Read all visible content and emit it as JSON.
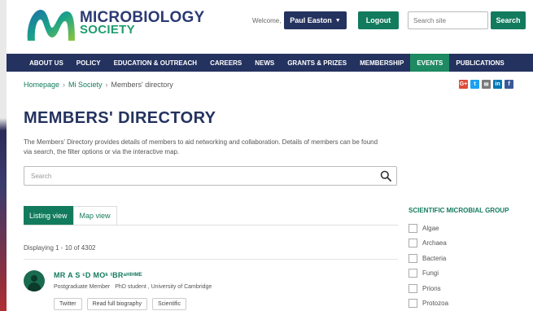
{
  "header": {
    "logo_line1": "MICROBIOLOGY",
    "logo_line2": "SOCIETY",
    "welcome": "Welcome,",
    "user_name": "Paul Easton",
    "logout": "Logout",
    "search_placeholder": "Search site",
    "search_button": "Search"
  },
  "nav": {
    "items": [
      "ABOUT US",
      "POLICY",
      "EDUCATION & OUTREACH",
      "CAREERS",
      "NEWS",
      "GRANTS & PRIZES",
      "MEMBERSHIP",
      "EVENTS",
      "PUBLICATIONS"
    ],
    "active": "EVENTS"
  },
  "breadcrumb": {
    "items": [
      "Homepage",
      "Mi Society",
      "Members' directory"
    ]
  },
  "share": {
    "icons": [
      "google-plus-icon",
      "twitter-icon",
      "email-icon",
      "linkedin-icon",
      "facebook-icon"
    ],
    "glyphs": [
      "G+",
      "t",
      "✉",
      "in",
      "f"
    ],
    "colors": [
      "#dd4b39",
      "#1da1f2",
      "#7a7a7a",
      "#0077b5",
      "#3b5998"
    ]
  },
  "page": {
    "title": "MEMBERS' DIRECTORY",
    "intro": "The Members' Directory provides details of members to aid networking and collaboration. Details of members can be found via search, the filter options or via the interactive map.",
    "search_placeholder": "Search"
  },
  "tabs": {
    "listing": "Listing view",
    "map": "Map view"
  },
  "results": {
    "count_text": "Displaying 1 - 10 of 4302"
  },
  "member": {
    "name": "MR A S ᵋD MOᵏ ᵗBRᵃᴴᴵᴴᴹᴱ",
    "membership": "Postgraduate Member",
    "position": "PhD student , University of Cambridge",
    "tags": [
      "Twitter",
      "Read full biography",
      "Scientific"
    ]
  },
  "filter": {
    "heading": "SCIENTIFIC MICROBIAL GROUP",
    "options": [
      "Algae",
      "Archaea",
      "Bacteria",
      "Fungi",
      "Prions",
      "Protozoa"
    ]
  },
  "colors": {
    "navy": "#24325f",
    "green": "#137b5d",
    "active_nav": "#1e8a62"
  }
}
